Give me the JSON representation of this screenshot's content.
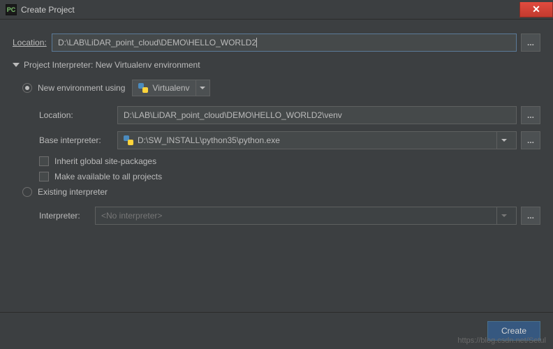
{
  "window": {
    "title": "Create Project"
  },
  "location_row": {
    "label": "Location:",
    "value": "D:\\LAB\\LiDAR_point_cloud\\DEMO\\HELLO_WORLD2"
  },
  "section": {
    "title": "Project Interpreter: New Virtualenv environment"
  },
  "radio_new": {
    "label": "New environment using",
    "combo": "Virtualenv"
  },
  "env": {
    "location_label": "Location:",
    "location_value": "D:\\LAB\\LiDAR_point_cloud\\DEMO\\HELLO_WORLD2\\venv",
    "base_label": "Base interpreter:",
    "base_value": "D:\\SW_INSTALL\\python35\\python.exe",
    "inherit": "Inherit global site-packages",
    "make_available": "Make available to all projects"
  },
  "radio_existing": {
    "label": "Existing interpreter"
  },
  "existing": {
    "label": "Interpreter:",
    "value": "<No interpreter>"
  },
  "buttons": {
    "create": "Create",
    "browse": "..."
  },
  "watermark": "https://blog.csdn.net/Setul"
}
